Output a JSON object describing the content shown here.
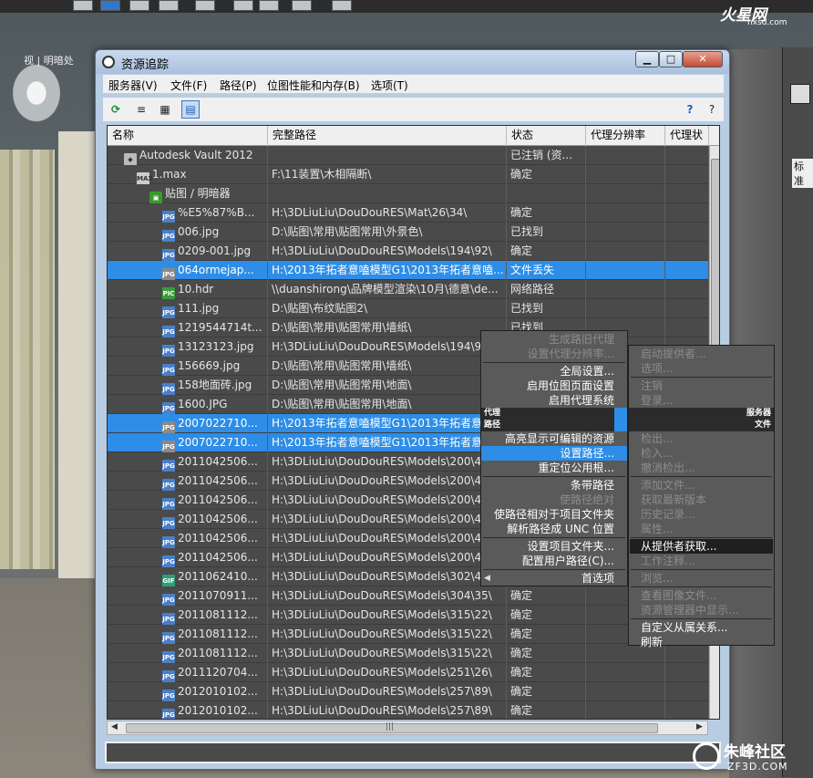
{
  "window": {
    "title": "资源追踪",
    "min_glyph": "▁",
    "max_glyph": "□",
    "close_glyph": "✕"
  },
  "menubar": [
    "服务器(V)",
    "文件(F)",
    "路径(P)",
    "位图性能和内存(B)",
    "选项(T)"
  ],
  "toolbar": {
    "tools": [
      "refresh-icon",
      "list-icon",
      "thumbnail-icon",
      "table-view-icon"
    ],
    "help_icons": [
      "help-icon",
      "context-help-icon"
    ]
  },
  "table": {
    "columns": [
      "名称",
      "完整路径",
      "状态",
      "代理分辨率",
      "代理状"
    ],
    "rows": [
      {
        "icon": "vault",
        "indent": 1,
        "name": "Autodesk Vault 2012",
        "path": "",
        "status": "已注销 (资...",
        "sel": false
      },
      {
        "icon": "max",
        "indent": 2,
        "name": "1.max",
        "path": "F:\\11装置\\木相隔断\\",
        "status": "确定",
        "sel": false
      },
      {
        "icon": "folder",
        "indent": 3,
        "name": "贴图 / 明暗器",
        "path": "",
        "status": "",
        "sel": false
      },
      {
        "icon": "jpg",
        "indent": 4,
        "name": "%E5%87%B...",
        "path": "H:\\3DLiuLiu\\DouDouRES\\Mat\\26\\34\\",
        "status": "确定",
        "sel": false
      },
      {
        "icon": "jpg",
        "indent": 4,
        "name": "006.jpg",
        "path": "D:\\贴图\\常用\\贴图常用\\外景色\\",
        "status": "已找到",
        "sel": false
      },
      {
        "icon": "jpg",
        "indent": 4,
        "name": "0209-001.jpg",
        "path": "H:\\3DLiuLiu\\DouDouRES\\Models\\194\\92\\",
        "status": "确定",
        "sel": false
      },
      {
        "icon": "jpg-grey",
        "indent": 4,
        "name": "064ormejap...",
        "path": "H:\\2013年拓者意嗑模型G1\\2013年拓者意嗑...",
        "status": "文件丢失",
        "sel": true
      },
      {
        "icon": "pic",
        "indent": 4,
        "name": "10.hdr",
        "path": "\\\\duanshirong\\品牌模型渲染\\10月\\德意\\de...",
        "status": "网络路径",
        "sel": false
      },
      {
        "icon": "jpg",
        "indent": 4,
        "name": "111.jpg",
        "path": "D:\\贴图\\布纹贴图2\\",
        "status": "已找到",
        "sel": false
      },
      {
        "icon": "jpg",
        "indent": 4,
        "name": "1219544714t...",
        "path": "D:\\贴图\\常用\\贴图常用\\墙纸\\",
        "status": "已找到",
        "sel": false
      },
      {
        "icon": "jpg",
        "indent": 4,
        "name": "13123123.jpg",
        "path": "H:\\3DLiuLiu\\DouDouRES\\Models\\194\\92",
        "status": "",
        "sel": false
      },
      {
        "icon": "jpg",
        "indent": 4,
        "name": "156669.jpg",
        "path": "D:\\贴图\\常用\\贴图常用\\墙纸\\",
        "status": "",
        "sel": false
      },
      {
        "icon": "jpg",
        "indent": 4,
        "name": "158地面砖.jpg",
        "path": "D:\\贴图\\常用\\贴图常用\\地面\\",
        "status": "",
        "sel": false
      },
      {
        "icon": "jpg",
        "indent": 4,
        "name": "1600.JPG",
        "path": "D:\\贴图\\常用\\贴图常用\\地面\\",
        "status": "",
        "sel": false
      },
      {
        "icon": "jpg-grey",
        "indent": 4,
        "name": "2007022710...",
        "path": "H:\\2013年拓者意嗑模型G1\\2013年拓者意嗑",
        "status": "",
        "sel": true
      },
      {
        "icon": "jpg-grey",
        "indent": 4,
        "name": "2007022710...",
        "path": "H:\\2013年拓者意嗑模型G1\\2013年拓者意嗑",
        "status": "",
        "sel": true
      },
      {
        "icon": "jpg",
        "indent": 4,
        "name": "2011042506...",
        "path": "H:\\3DLiuLiu\\DouDouRES\\Models\\200\\4",
        "status": "",
        "sel": false
      },
      {
        "icon": "jpg",
        "indent": 4,
        "name": "2011042506...",
        "path": "H:\\3DLiuLiu\\DouDouRES\\Models\\200\\4",
        "status": "",
        "sel": false
      },
      {
        "icon": "jpg",
        "indent": 4,
        "name": "2011042506...",
        "path": "H:\\3DLiuLiu\\DouDouRES\\Models\\200\\4",
        "status": "",
        "sel": false
      },
      {
        "icon": "jpg",
        "indent": 4,
        "name": "2011042506...",
        "path": "H:\\3DLiuLiu\\DouDouRES\\Models\\200\\4",
        "status": "",
        "sel": false
      },
      {
        "icon": "jpg",
        "indent": 4,
        "name": "2011042506...",
        "path": "H:\\3DLiuLiu\\DouDouRES\\Models\\200\\4",
        "status": "",
        "sel": false
      },
      {
        "icon": "jpg",
        "indent": 4,
        "name": "2011042506...",
        "path": "H:\\3DLiuLiu\\DouDouRES\\Models\\200\\4",
        "status": "",
        "sel": false
      },
      {
        "icon": "gif",
        "indent": 4,
        "name": "2011062410...",
        "path": "H:\\3DLiuLiu\\DouDouRES\\Models\\302\\4",
        "status": "",
        "sel": false
      },
      {
        "icon": "jpg",
        "indent": 4,
        "name": "2011070911...",
        "path": "H:\\3DLiuLiu\\DouDouRES\\Models\\304\\35\\",
        "status": "确定",
        "sel": false
      },
      {
        "icon": "jpg",
        "indent": 4,
        "name": "2011081112...",
        "path": "H:\\3DLiuLiu\\DouDouRES\\Models\\315\\22\\",
        "status": "确定",
        "sel": false
      },
      {
        "icon": "jpg",
        "indent": 4,
        "name": "2011081112...",
        "path": "H:\\3DLiuLiu\\DouDouRES\\Models\\315\\22\\",
        "status": "确定",
        "sel": false
      },
      {
        "icon": "jpg",
        "indent": 4,
        "name": "2011081112...",
        "path": "H:\\3DLiuLiu\\DouDouRES\\Models\\315\\22\\",
        "status": "确定",
        "sel": false
      },
      {
        "icon": "jpg",
        "indent": 4,
        "name": "2011120704...",
        "path": "H:\\3DLiuLiu\\DouDouRES\\Models\\251\\26\\",
        "status": "确定",
        "sel": false
      },
      {
        "icon": "jpg",
        "indent": 4,
        "name": "2012010102...",
        "path": "H:\\3DLiuLiu\\DouDouRES\\Models\\257\\89\\",
        "status": "确定",
        "sel": false
      },
      {
        "icon": "jpg",
        "indent": 4,
        "name": "2012010102...",
        "path": "H:\\3DLiuLiu\\DouDouRES\\Models\\257\\89\\",
        "status": "确定",
        "sel": false
      }
    ]
  },
  "context_menu": {
    "items": [
      {
        "label": "生成路旧代理",
        "disabled": true,
        "hl": false
      },
      {
        "label": "设置代理分辨率...",
        "disabled": true,
        "hl": false
      },
      {
        "sep": true
      },
      {
        "label": "全局设置...",
        "disabled": false,
        "hl": false
      },
      {
        "label": "启用位图页面设置",
        "disabled": false,
        "hl": false
      },
      {
        "label": "启用代理系统",
        "disabled": false,
        "hl": false
      },
      {
        "head": "代理"
      },
      {
        "head": "路径"
      },
      {
        "label": "高亮显示可编辑的资源",
        "disabled": false,
        "hl": false
      },
      {
        "label": "设置路径...",
        "disabled": false,
        "hl": true
      },
      {
        "label": "重定位公用根...",
        "disabled": false,
        "hl": false
      },
      {
        "sep": true
      },
      {
        "label": "条带路径",
        "disabled": false,
        "hl": false
      },
      {
        "label": "使路径绝对",
        "disabled": true,
        "hl": false
      },
      {
        "label": "使路径相对于项目文件夹",
        "disabled": false,
        "hl": false
      },
      {
        "label": "解析路径成 UNC 位置",
        "disabled": false,
        "hl": false
      },
      {
        "sep": true
      },
      {
        "label": "设置项目文件夹...",
        "disabled": false,
        "hl": false
      },
      {
        "label": "配置用户路径(C)...",
        "disabled": false,
        "hl": false
      },
      {
        "sep": true
      },
      {
        "label": "首选项",
        "disabled": false,
        "hl": false,
        "arrow": "◀"
      }
    ]
  },
  "server_menu": {
    "items": [
      {
        "label": "启动提供者...",
        "disabled": true
      },
      {
        "label": "选项...",
        "disabled": true
      },
      {
        "sep": true
      },
      {
        "label": "注销",
        "disabled": true
      },
      {
        "label": "登录...",
        "disabled": true
      },
      {
        "head": "服务器"
      },
      {
        "head": "文件"
      },
      {
        "label": "检出...",
        "disabled": true
      },
      {
        "label": "检入...",
        "disabled": true
      },
      {
        "label": "撤消检出...",
        "disabled": true
      },
      {
        "sep": true
      },
      {
        "label": "添加文件...",
        "disabled": true
      },
      {
        "label": "获取最新版本",
        "disabled": true
      },
      {
        "label": "历史记录...",
        "disabled": true
      },
      {
        "label": "属性...",
        "disabled": true
      },
      {
        "sep": true
      },
      {
        "label": "从提供者获取...",
        "disabled": false,
        "on": true
      },
      {
        "label": "工作注释...",
        "disabled": true
      },
      {
        "sep": true
      },
      {
        "label": "浏览...",
        "disabled": true
      },
      {
        "sep": true
      },
      {
        "label": "查看图像文件...",
        "disabled": true
      },
      {
        "label": "资源管理器中显示...",
        "disabled": true
      },
      {
        "sep": true
      },
      {
        "label": "自定义从属关系...",
        "disabled": false,
        "on": false
      },
      {
        "label": "刷新",
        "disabled": false,
        "on": false
      }
    ]
  },
  "scroll": {
    "left_arrow": "◀",
    "right_arrow": "▶",
    "grip": "|||"
  },
  "viewport": {
    "label": "视 | 明暗处"
  },
  "watermarks": {
    "hx_big": "火星网",
    "hx_small": "hxsd.com",
    "zf_big": "朱峰社区",
    "zf_small": "ZF3D.COM"
  },
  "right_panel": {
    "label": "标准"
  }
}
